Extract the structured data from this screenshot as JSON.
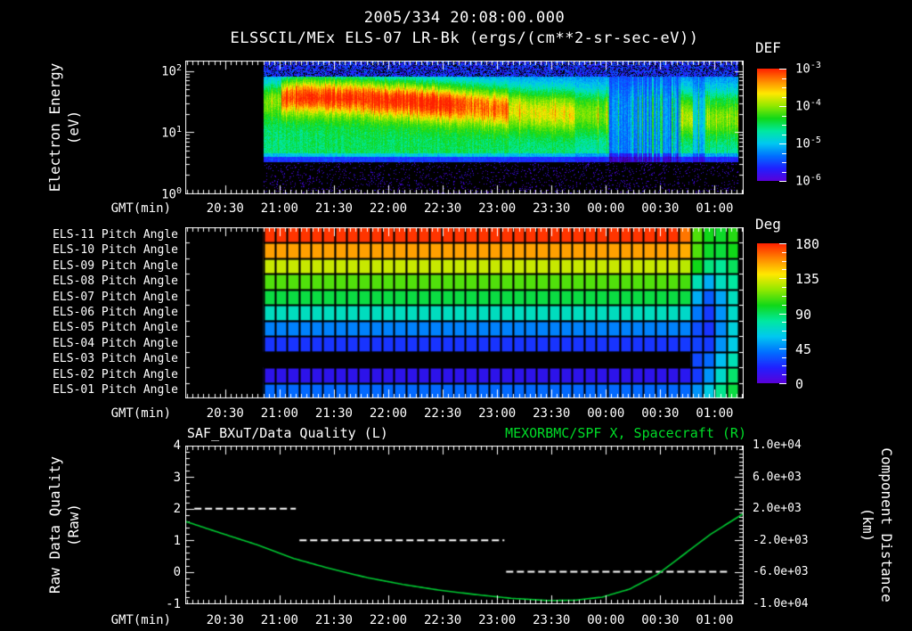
{
  "colors": {
    "background": "#000000",
    "foreground": "#ffffff",
    "series_green": "#00c832",
    "title_green": "#00dc28"
  },
  "header": {
    "datetime": "2005/334 20:08:00.000",
    "title": "ELSSCIL/MEx ELS-07 LR-Bk  (ergs/(cm**2-sr-sec-eV))"
  },
  "time_axis": {
    "label": "GMT(min)",
    "tick_labels": [
      "20:30",
      "21:00",
      "21:30",
      "22:00",
      "22:30",
      "23:00",
      "23:30",
      "00:00",
      "00:30",
      "01:00"
    ],
    "first_tick_min": 22,
    "tick_step_min": 30,
    "minor_step_min": 3,
    "total_min": 308
  },
  "rainbow_stops": [
    [
      0.0,
      "#2a0060"
    ],
    [
      0.1,
      "#4400c8"
    ],
    [
      0.22,
      "#2020ff"
    ],
    [
      0.34,
      "#0070ff"
    ],
    [
      0.44,
      "#00c8f0"
    ],
    [
      0.52,
      "#00e8a0"
    ],
    [
      0.6,
      "#10d818"
    ],
    [
      0.72,
      "#90e800"
    ],
    [
      0.8,
      "#ffe800"
    ],
    [
      0.88,
      "#ff8800"
    ],
    [
      1.0,
      "#ff2000"
    ]
  ],
  "colorbar_stops": [
    "#5a00d8",
    "#2020ff",
    "#0070ff",
    "#00c8f0",
    "#00e8a0",
    "#10d818",
    "#90e800",
    "#ffe800",
    "#ff8800",
    "#ff2000"
  ],
  "chart_data": [
    {
      "type": "heatmap",
      "name": "electron-energy-spectrogram",
      "title": "ELSSCIL/MEx ELS-07 LR-Bk",
      "units": "(ergs/(cm**2-sr-sec-eV))",
      "ylabel": "Electron Energy",
      "ylabel_units": "(eV)",
      "xlabel": "GMT(min)",
      "x_tick_labels": [
        "20:30",
        "21:00",
        "21:30",
        "22:00",
        "22:30",
        "23:00",
        "23:30",
        "00:00",
        "00:30",
        "01:00"
      ],
      "y_scale": "log",
      "y_tick_exponents": [
        2,
        1,
        0
      ],
      "ylim_exp": [
        0,
        2.17
      ],
      "colorbar": {
        "title": "DEF",
        "tick_exponents": [
          -3,
          -4,
          -5,
          -6
        ]
      },
      "data_start_min": 43,
      "data_end_min": 305,
      "core_center_exp": [
        [
          43,
          1.5
        ],
        [
          60,
          1.62
        ],
        [
          95,
          1.58
        ],
        [
          125,
          1.52
        ],
        [
          160,
          1.42
        ],
        [
          195,
          1.32
        ],
        [
          230,
          1.28
        ],
        [
          305,
          1.22
        ]
      ],
      "segments": [
        {
          "t0": 43,
          "t1": 53,
          "core": 0.35,
          "patchy": 0.1
        },
        {
          "t0": 53,
          "t1": 150,
          "core": 0.92,
          "patchy": 0.0
        },
        {
          "t0": 150,
          "t1": 178,
          "core": 0.75,
          "patchy": 0.0
        },
        {
          "t0": 178,
          "t1": 215,
          "core": 0.55,
          "patchy": 0.08
        },
        {
          "t0": 215,
          "t1": 233,
          "core": 0.45,
          "patchy": 0.2
        },
        {
          "t0": 233,
          "t1": 273,
          "core": 0.1,
          "patchy": 0.8
        },
        {
          "t0": 273,
          "t1": 280,
          "core": 0.5,
          "patchy": 0.15
        },
        {
          "t0": 280,
          "t1": 287,
          "core": 0.15,
          "patchy": 0.6
        },
        {
          "t0": 287,
          "t1": 305,
          "core": 0.45,
          "patchy": 0.22
        }
      ]
    },
    {
      "type": "heatmap",
      "name": "pitch-angle-panel",
      "xlabel": "GMT(min)",
      "x_tick_labels": [
        "20:30",
        "21:00",
        "21:30",
        "22:00",
        "22:30",
        "23:00",
        "23:30",
        "00:00",
        "00:30",
        "01:00"
      ],
      "vmin": 0,
      "vmax": 180,
      "colorbar": {
        "title": "Deg",
        "ticks": [
          180,
          135,
          90,
          45,
          0
        ]
      },
      "data_start_min": 43,
      "data_end_min": 305,
      "tail_start_min": 269,
      "n_cols": 40,
      "rows": [
        {
          "label": "ELS-11 Pitch Angle",
          "angle": 175,
          "tail": [
            160,
            112,
            100,
            98,
            104,
            100
          ]
        },
        {
          "label": "ELS-10 Pitch Angle",
          "angle": 152,
          "tail": [
            150,
            112,
            98,
            96,
            100,
            100
          ]
        },
        {
          "label": "ELS-09 Pitch Angle",
          "angle": 132,
          "tail": [
            130,
            100,
            88,
            85,
            92,
            88
          ]
        },
        {
          "label": "ELS-08 Pitch Angle",
          "angle": 112,
          "tail": [
            110,
            80,
            62,
            78,
            84,
            86
          ]
        },
        {
          "label": "ELS-07 Pitch Angle",
          "angle": 95,
          "tail": [
            95,
            62,
            42,
            60,
            78,
            82
          ]
        },
        {
          "label": "ELS-06 Pitch Angle",
          "angle": 78,
          "tail": [
            76,
            50,
            32,
            56,
            76,
            86
          ]
        },
        {
          "label": "ELS-05 Pitch Angle",
          "angle": 52,
          "tail": [
            52,
            38,
            30,
            54,
            72,
            76
          ]
        },
        {
          "label": "ELS-04 Pitch Angle",
          "angle": 30,
          "tail": [
            32,
            34,
            32,
            56,
            70,
            74
          ]
        },
        {
          "label": "ELS-03 Pitch Angle",
          "angle": null,
          "tail": [
            null,
            36,
            46,
            66,
            80,
            90
          ]
        },
        {
          "label": "ELS-02 Pitch Angle",
          "angle": 15,
          "tail": [
            18,
            32,
            56,
            76,
            90,
            95
          ]
        },
        {
          "label": "ELS-01 Pitch Angle",
          "angle": 46,
          "tail": [
            46,
            56,
            70,
            86,
            95,
            95
          ]
        }
      ]
    },
    {
      "type": "line",
      "name": "quality-distance-plot",
      "title_left": "SAF_BXuT/Data Quality (L)",
      "title_right": "MEXORBMC/SPF X, Spacecraft (R)",
      "ylabel_left": "Raw Data Quality",
      "ylabel_left_units": "(Raw)",
      "ylabel_right": "Component Distance",
      "ylabel_right_units": "(km)",
      "xlabel": "GMT(min)",
      "x_tick_labels": [
        "20:30",
        "21:00",
        "21:30",
        "22:00",
        "22:30",
        "23:00",
        "23:30",
        "00:00",
        "00:30",
        "01:00"
      ],
      "ylim_left": [
        -1,
        4
      ],
      "left_tick_labels": [
        "4",
        "3",
        "2",
        "1",
        "0",
        "-1"
      ],
      "right_tick_labels": [
        "1.0e+04",
        "6.0e+03",
        "2.0e+03",
        "-2.0e+03",
        "-6.0e+03",
        "-1.0e+04"
      ],
      "series": [
        {
          "name": "SAF_BXuT/Data Quality (L)",
          "axis": "left",
          "style": "dashed",
          "color": "#ffffff",
          "segments": [
            {
              "t0": 5,
              "t1": 61,
              "value": 2
            },
            {
              "t0": 63,
              "t1": 176,
              "value": 1
            },
            {
              "t0": 177,
              "t1": 299,
              "value": 0
            }
          ]
        },
        {
          "name": "MEXORBMC/SPF X, Spacecraft (R)",
          "axis": "right",
          "style": "solid",
          "color": "#00c832",
          "points_raw": [
            [
              0,
              1.6
            ],
            [
              20,
              1.22
            ],
            [
              40,
              0.85
            ],
            [
              60,
              0.42
            ],
            [
              80,
              0.1
            ],
            [
              100,
              -0.18
            ],
            [
              120,
              -0.4
            ],
            [
              140,
              -0.58
            ],
            [
              160,
              -0.72
            ],
            [
              180,
              -0.84
            ],
            [
              200,
              -0.91
            ],
            [
              215,
              -0.9
            ],
            [
              230,
              -0.8
            ],
            [
              245,
              -0.55
            ],
            [
              260,
              -0.1
            ],
            [
              275,
              0.55
            ],
            [
              290,
              1.2
            ],
            [
              308,
              1.85
            ]
          ]
        }
      ]
    }
  ]
}
